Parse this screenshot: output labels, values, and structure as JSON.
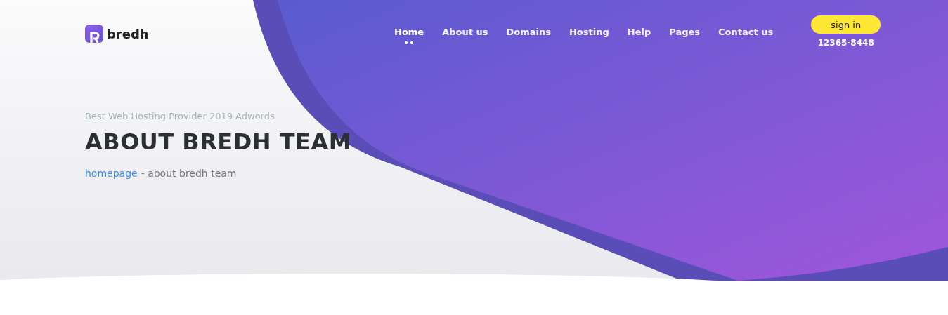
{
  "logo": {
    "text": "bredh"
  },
  "nav": [
    {
      "label": "Home",
      "selected": true
    },
    {
      "label": "About us",
      "selected": false
    },
    {
      "label": "Domains",
      "selected": false
    },
    {
      "label": "Hosting",
      "selected": false
    },
    {
      "label": "Help",
      "selected": false
    },
    {
      "label": "Pages",
      "selected": false
    },
    {
      "label": "Contact us",
      "selected": false
    }
  ],
  "sign_in": {
    "label": "sign in"
  },
  "phone": "12365-8448",
  "hero": {
    "subtitle": "Best Web Hosting Provider 2019 Adwords",
    "title": "ABOUT BREDH TEAM",
    "breadcrumb": {
      "link": "homepage",
      "current": "- about bredh team"
    }
  }
}
